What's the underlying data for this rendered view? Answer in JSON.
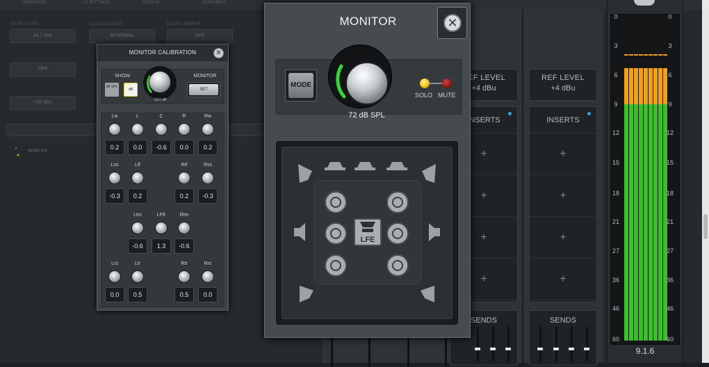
{
  "background": {
    "tabs": [
      "HARDWARE",
      "UI SETTINGS",
      "DISPLAY",
      "SCENARIOS"
    ],
    "fields": [
      {
        "label": "SAMPLE RATE",
        "value": "44.1 kHz"
      },
      {
        "label": "CLOCK SOURCE",
        "value": "INTERNAL"
      },
      {
        "label": "DIGITAL MIRROR",
        "value": "OFF"
      },
      {
        "label": "",
        "value": "OFF"
      },
      {
        "label": "",
        "value": "+20 dBu"
      }
    ],
    "devices_label": "DEVICES",
    "device_name": "Apollo x16"
  },
  "calibration": {
    "title": "MONITOR CALIBRATION",
    "close_glyph": "✕",
    "show_label": "SHOW",
    "show_btn1": "dB SPL",
    "show_btn2": "dB",
    "knob_value": "-18.0 dB",
    "monitor_label": "MONITOR",
    "set_label": "SET",
    "channels": [
      {
        "name": "Lw",
        "value": "0.2"
      },
      {
        "name": "L",
        "value": "0.0"
      },
      {
        "name": "C",
        "value": "-0.6"
      },
      {
        "name": "R",
        "value": "0.0"
      },
      {
        "name": "Rw",
        "value": "0.2"
      },
      {
        "name": "Lss",
        "value": "-0.3"
      },
      {
        "name": "Ltf",
        "value": "0.2"
      },
      {
        "name": "Rtf",
        "value": "0.2"
      },
      {
        "name": "Rss",
        "value": "-0.3"
      },
      {
        "name": "Ltm",
        "value": "-0.6"
      },
      {
        "name": "LFE",
        "value": "1.3"
      },
      {
        "name": "Rtm",
        "value": "-0.6"
      },
      {
        "name": "Lrs",
        "value": "0.0"
      },
      {
        "name": "Ltr",
        "value": "0.5"
      },
      {
        "name": "Rtr",
        "value": "0.5"
      },
      {
        "name": "Rrs",
        "value": "0.0"
      }
    ]
  },
  "monitor": {
    "title": "MONITOR",
    "close_glyph": "✕",
    "mode_label": "MODE",
    "level": "72 dB SPL",
    "solo_label": "SOLO",
    "mute_label": "MUTE",
    "lfe_label": "LFE",
    "colors": {
      "solo": "#f2c31c",
      "mute": "#8e1a12",
      "ring": "#3ad13a"
    }
  },
  "strips": [
    {
      "ref_title": "REF LEVEL",
      "ref_value": "+4 dBu",
      "inserts": "INSERTS",
      "sends": "SENDS"
    },
    {
      "ref_title": "REF LEVEL",
      "ref_value": "+4 dBu",
      "inserts": "INSERTS",
      "sends": "SENDS"
    }
  ],
  "insert_slot": "+",
  "meter": {
    "scale": [
      "0",
      "3",
      "6",
      "9",
      "12",
      "15",
      "18",
      "21",
      "27",
      "36",
      "46",
      "60"
    ],
    "format": "9.1.6",
    "colors": {
      "green": "#3cbf2a",
      "orange": "#f0a21c"
    }
  }
}
